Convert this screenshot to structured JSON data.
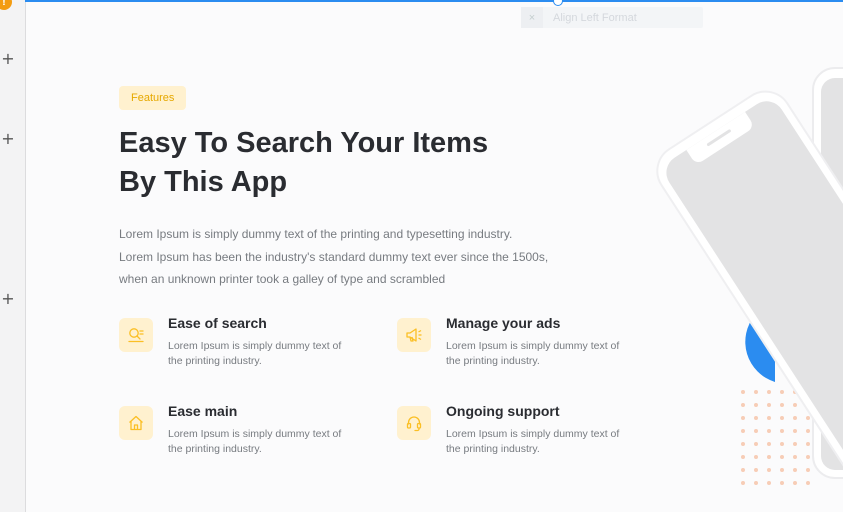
{
  "editor": {
    "warning_badge": "!",
    "add_block_symbol": "+",
    "toolbar_label": "Align Left Format",
    "toolbar_close": "×"
  },
  "section": {
    "tag": "Features",
    "title_line1": "Easy To Search Your Items",
    "title_line2": "By This App",
    "desc_line1": "Lorem Ipsum is simply dummy text of the printing and typesetting industry.",
    "desc_line2": "Lorem Ipsum has been the industry's standard dummy text ever since the 1500s,",
    "desc_line3": "when an unknown printer took a galley of type and scrambled"
  },
  "features": [
    {
      "title": "Ease of search",
      "desc": "Lorem Ipsum is simply dummy text of the printing industry.",
      "icon": "search-list-icon"
    },
    {
      "title": "Manage your ads",
      "desc": "Lorem Ipsum is simply dummy text of the printing industry.",
      "icon": "megaphone-icon"
    },
    {
      "title": "Ease main",
      "desc": "Lorem Ipsum is simply dummy text of the printing industry.",
      "icon": "home-icon"
    },
    {
      "title": "Ongoing support",
      "desc": "Lorem Ipsum is simply dummy text of the printing industry.",
      "icon": "headset-icon"
    }
  ],
  "colors": {
    "accent": "#fbbf24",
    "accent_bg": "#fff1cf",
    "selection": "#2b8cf0",
    "title": "#2a2c31",
    "body_text": "#777b80"
  }
}
